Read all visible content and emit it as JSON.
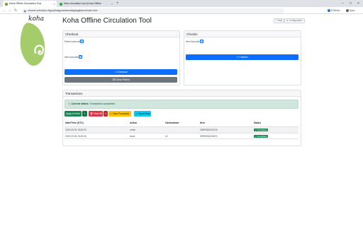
{
  "browser": {
    "tabs": [
      {
        "label": "Koha Offline Circulation Tool",
        "favicon_color": "#7aa63a"
      },
      {
        "label": "New circulation tool (Koha Offline",
        "favicon_color": "#34a853"
      }
    ],
    "url": "chrome-extension://kgoadloiagmiedoeimlbfgeigajbdnm/index.html",
    "extensions": [
      {
        "label": "CSM for...",
        "color": "#1a73e8"
      },
      {
        "label": "Sync",
        "color": "#5f6368"
      }
    ]
  },
  "header": {
    "brand": "koha",
    "title": "Koha Offline Circulation Tool",
    "help_label": "Help",
    "config_label": "Configuration"
  },
  "checkout": {
    "heading": "Checkout",
    "patron_label": "Patron barcode:",
    "item_label": "Item barcode:",
    "checkout_button": "Checkout",
    "clear_button": "Clear Patron"
  },
  "checkin": {
    "heading": "Checkin",
    "item_label": "Item barcode:",
    "checkin_button": "Checkin"
  },
  "transactions": {
    "heading": "Transactions",
    "status_label": "Current status:",
    "status_value": "Transaction completed.",
    "actions": [
      {
        "label": "Apply to Koha",
        "color": "#198754"
      },
      {
        "label": "Clear All",
        "color": "#dc3545"
      },
      {
        "label": "Clear Processed",
        "color": "#ffc107"
      },
      {
        "label": "Export Data",
        "color": "#0dcaf0"
      }
    ],
    "columns": [
      "Date/Time (UTC)",
      "Action",
      "Cardnumber",
      "Item",
      "Status"
    ],
    "rows": [
      {
        "datetime": "2025-09-30 15:50:53",
        "action": "return",
        "cardnumber": "",
        "item": "39999000001310",
        "status": "Completed"
      },
      {
        "datetime": "2025-09-30 15:49:46",
        "action": "issue",
        "cardnumber": "42",
        "item": "39999000004571",
        "status": "Completed"
      }
    ]
  }
}
